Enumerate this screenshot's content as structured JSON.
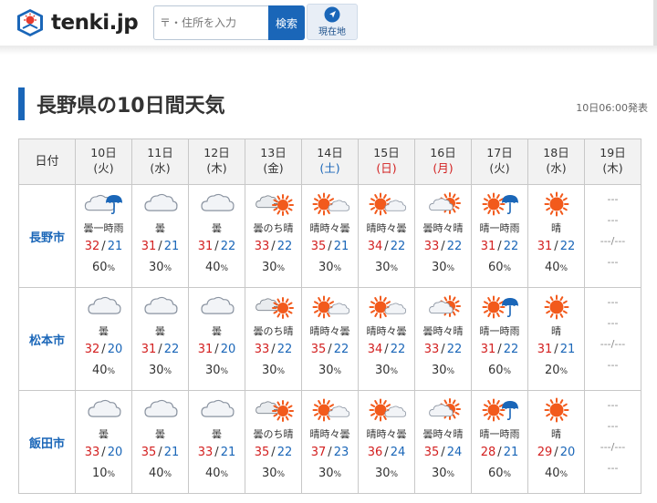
{
  "brand": {
    "name": "tenki.jp"
  },
  "search": {
    "placeholder": "〒・住所を入力",
    "button_label": "検索"
  },
  "location_button": {
    "label": "現在地"
  },
  "page": {
    "title": "長野県の10日間天気",
    "issued": "10日06:00発表"
  },
  "table": {
    "date_label": "日付",
    "days": [
      {
        "date": "10日",
        "dow": "(火)",
        "dow_type": "weekday"
      },
      {
        "date": "11日",
        "dow": "(水)",
        "dow_type": "weekday"
      },
      {
        "date": "12日",
        "dow": "(木)",
        "dow_type": "weekday"
      },
      {
        "date": "13日",
        "dow": "(金)",
        "dow_type": "weekday"
      },
      {
        "date": "14日",
        "dow": "(土)",
        "dow_type": "sat"
      },
      {
        "date": "15日",
        "dow": "(日)",
        "dow_type": "hol"
      },
      {
        "date": "16日",
        "dow": "(月)",
        "dow_type": "hol"
      },
      {
        "date": "17日",
        "dow": "(火)",
        "dow_type": "weekday"
      },
      {
        "date": "18日",
        "dow": "(水)",
        "dow_type": "weekday"
      },
      {
        "date": "19日",
        "dow": "(木)",
        "dow_type": "weekday"
      }
    ],
    "cities": [
      {
        "name": "長野市",
        "forecasts": [
          {
            "icon": "cloud-temp-rain-icon",
            "telop": "曇一時雨",
            "max": "32",
            "min": "21",
            "prob": "60"
          },
          {
            "icon": "cloudy-icon",
            "telop": "曇",
            "max": "31",
            "min": "21",
            "prob": "30"
          },
          {
            "icon": "cloudy-icon",
            "telop": "曇",
            "max": "31",
            "min": "22",
            "prob": "40"
          },
          {
            "icon": "cloud-then-sun-icon",
            "telop": "曇のち晴",
            "max": "33",
            "min": "22",
            "prob": "30"
          },
          {
            "icon": "sun-occasional-cloud-icon",
            "telop": "晴時々曇",
            "max": "35",
            "min": "21",
            "prob": "30"
          },
          {
            "icon": "sun-occasional-cloud-icon",
            "telop": "晴時々曇",
            "max": "34",
            "min": "22",
            "prob": "30"
          },
          {
            "icon": "cloud-occasional-sun-icon",
            "telop": "曇時々晴",
            "max": "33",
            "min": "22",
            "prob": "30"
          },
          {
            "icon": "sun-temp-rain-icon",
            "telop": "晴一時雨",
            "max": "31",
            "min": "22",
            "prob": "60"
          },
          {
            "icon": "sunny-icon",
            "telop": "晴",
            "max": "31",
            "min": "22",
            "prob": "40"
          }
        ]
      },
      {
        "name": "松本市",
        "forecasts": [
          {
            "icon": "cloudy-icon",
            "telop": "曇",
            "max": "32",
            "min": "20",
            "prob": "40"
          },
          {
            "icon": "cloudy-icon",
            "telop": "曇",
            "max": "31",
            "min": "22",
            "prob": "30"
          },
          {
            "icon": "cloudy-icon",
            "telop": "曇",
            "max": "31",
            "min": "20",
            "prob": "30"
          },
          {
            "icon": "cloud-then-sun-icon",
            "telop": "曇のち晴",
            "max": "33",
            "min": "22",
            "prob": "30"
          },
          {
            "icon": "sun-occasional-cloud-icon",
            "telop": "晴時々曇",
            "max": "35",
            "min": "22",
            "prob": "30"
          },
          {
            "icon": "sun-occasional-cloud-icon",
            "telop": "晴時々曇",
            "max": "34",
            "min": "22",
            "prob": "30"
          },
          {
            "icon": "cloud-occasional-sun-icon",
            "telop": "曇時々晴",
            "max": "33",
            "min": "22",
            "prob": "30"
          },
          {
            "icon": "sun-temp-rain-icon",
            "telop": "晴一時雨",
            "max": "31",
            "min": "22",
            "prob": "60"
          },
          {
            "icon": "sunny-icon",
            "telop": "晴",
            "max": "31",
            "min": "21",
            "prob": "20"
          }
        ]
      },
      {
        "name": "飯田市",
        "forecasts": [
          {
            "icon": "cloudy-icon",
            "telop": "曇",
            "max": "33",
            "min": "20",
            "prob": "10"
          },
          {
            "icon": "cloudy-icon",
            "telop": "曇",
            "max": "35",
            "min": "21",
            "prob": "40"
          },
          {
            "icon": "cloudy-icon",
            "telop": "曇",
            "max": "33",
            "min": "21",
            "prob": "40"
          },
          {
            "icon": "cloud-then-sun-icon",
            "telop": "曇のち晴",
            "max": "35",
            "min": "22",
            "prob": "30"
          },
          {
            "icon": "sun-occasional-cloud-icon",
            "telop": "晴時々曇",
            "max": "37",
            "min": "23",
            "prob": "30"
          },
          {
            "icon": "sun-occasional-cloud-icon",
            "telop": "晴時々曇",
            "max": "36",
            "min": "24",
            "prob": "30"
          },
          {
            "icon": "cloud-occasional-sun-icon",
            "telop": "曇時々晴",
            "max": "35",
            "min": "24",
            "prob": "30"
          },
          {
            "icon": "sun-temp-rain-icon",
            "telop": "晴一時雨",
            "max": "28",
            "min": "21",
            "prob": "60"
          },
          {
            "icon": "sunny-icon",
            "telop": "晴",
            "max": "29",
            "min": "20",
            "prob": "40"
          }
        ]
      }
    ],
    "unavailable": {
      "icon": "---",
      "telop": "---",
      "temp": "---/---",
      "prob": "---"
    },
    "prob_unit": "%"
  },
  "colors": {
    "accent": "#1a66b8",
    "max_temp": "#d32020",
    "min_temp": "#1a66b8",
    "sun": "#f25a1c",
    "rain": "#1a66b8"
  }
}
